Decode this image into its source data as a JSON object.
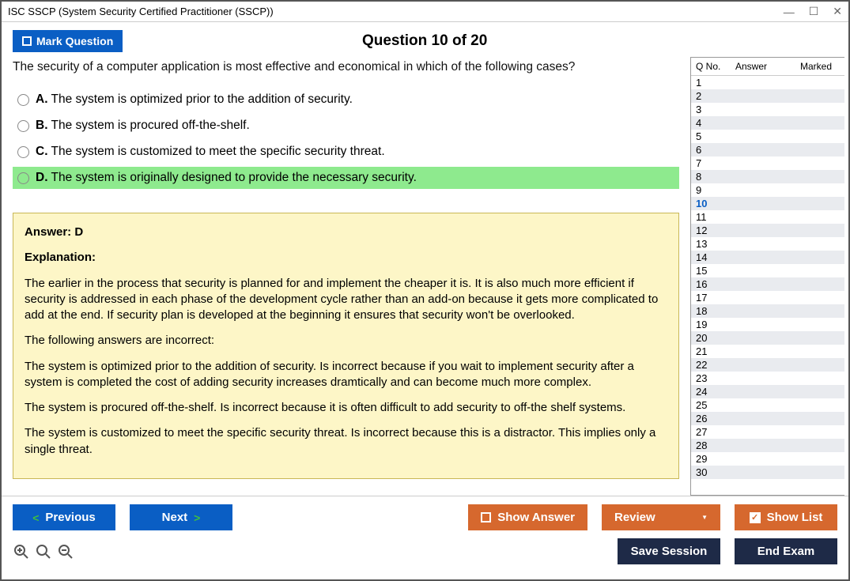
{
  "window": {
    "title": "ISC SSCP (System Security Certified Practitioner (SSCP))"
  },
  "header": {
    "mark": "Mark Question",
    "qtitle": "Question 10 of 20"
  },
  "question": {
    "text": "The security of a computer application is most effective and economical in which of the following cases?",
    "options": [
      {
        "letter": "A.",
        "text": "The system is optimized prior to the addition of security.",
        "selected": false
      },
      {
        "letter": "B.",
        "text": "The system is procured off-the-shelf.",
        "selected": false
      },
      {
        "letter": "C.",
        "text": "The system is customized to meet the specific security threat.",
        "selected": false
      },
      {
        "letter": "D.",
        "text": "The system is originally designed to provide the necessary security.",
        "selected": true
      }
    ]
  },
  "answer": {
    "head": "Answer: D",
    "exphead": "Explanation:",
    "p1": "The earlier in the process that security is planned for and implement the cheaper it is. It is also much more efficient if security is addressed in each phase of the development cycle rather than an add-on because it gets more complicated to add at the end. If security plan is developed at the beginning it ensures that security won't be overlooked.",
    "p2": "The following answers are incorrect:",
    "p3": "The system is optimized prior to the addition of security. Is incorrect because if you wait to implement security after a system is completed the cost of adding security increases dramtically and can become much more complex.",
    "p4": "The system is procured off-the-shelf. Is incorrect because it is often difficult to add security to off-the shelf systems.",
    "p5": "The system is customized to meet the specific security threat. Is incorrect because this is a distractor. This implies only a single threat."
  },
  "sidebar": {
    "h1": "Q No.",
    "h2": "Answer",
    "h3": "Marked",
    "current": 10,
    "total": 30
  },
  "footer": {
    "prev": "Previous",
    "next": "Next",
    "show": "Show Answer",
    "review": "Review",
    "showlist": "Show List",
    "save": "Save Session",
    "end": "End Exam"
  }
}
